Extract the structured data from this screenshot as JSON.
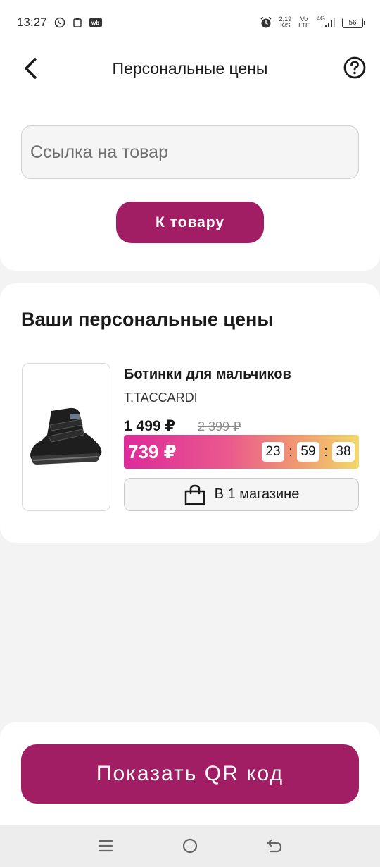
{
  "status_bar": {
    "time": "13:27",
    "wb_badge": "wb",
    "net_speed_value": "2,19",
    "net_speed_unit": "K/S",
    "volte_top": "Vo",
    "volte_bottom": "LTE",
    "network": "4G",
    "battery": "56"
  },
  "header": {
    "title": "Персональные цены"
  },
  "search": {
    "placeholder": "Ссылка на товар",
    "value": ""
  },
  "to_product_button": "К товару",
  "prices_section": {
    "title": "Ваши персональные цены",
    "product": {
      "name": "Ботинки для мальчиков",
      "brand": "T.TACCARDI",
      "price": "1 499 ₽",
      "old_price": "2 399 ₽",
      "personal_price": "739 ₽",
      "timer": {
        "hours": "23",
        "minutes": "59",
        "seconds": "38",
        "separator": ":"
      },
      "stores_label": "В 1 магазине"
    }
  },
  "qr_button": "Показать QR код",
  "colors": {
    "brand": "#a11e64",
    "promo_gradient_start": "#dd2a9b",
    "promo_gradient_end": "#f1d86a"
  }
}
